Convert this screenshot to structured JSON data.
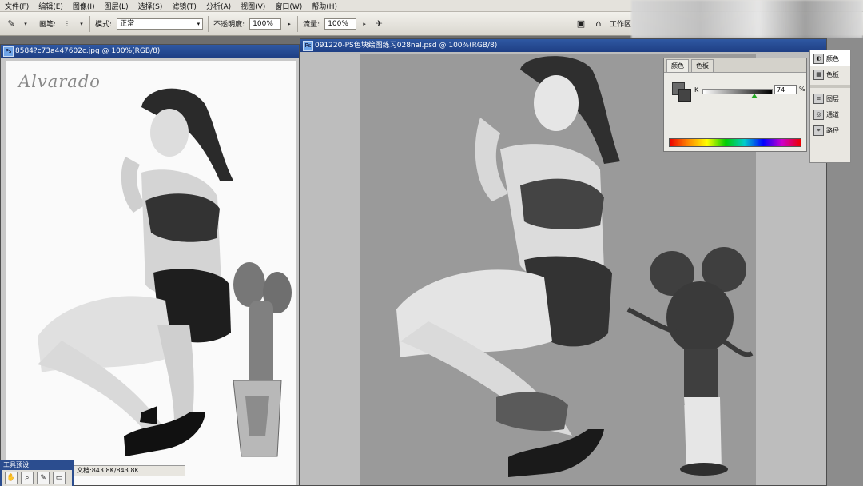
{
  "menu": [
    "文件(F)",
    "编辑(E)",
    "图像(I)",
    "图层(L)",
    "选择(S)",
    "滤镜(T)",
    "分析(A)",
    "视图(V)",
    "窗口(W)",
    "帮助(H)"
  ],
  "options": {
    "brush_label": "画笔:",
    "mode_label": "模式:",
    "mode_value": "正常",
    "opacity_label": "不透明度:",
    "opacity_value": "100%",
    "flow_label": "流量:",
    "flow_value": "100%",
    "workspace_label": "工作区"
  },
  "doc1": {
    "title": "8584?c73a447602c.jpg @ 100%(RGB/8)",
    "watermark": "Alvarado",
    "status": "文档:843.8K/843.8K"
  },
  "doc2": {
    "title": "091220-PS色块绘图练习028nal.psd @ 100%(RGB/8)"
  },
  "color_panel": {
    "tabs": [
      "颜色",
      "色板"
    ],
    "channel": "K",
    "value": "74",
    "unit": "%",
    "k_level": 0.74
  },
  "dock": {
    "items": [
      "颜色",
      "色板",
      "图层",
      "通道",
      "路径"
    ]
  },
  "mini_panel": {
    "title": "工具预设"
  }
}
